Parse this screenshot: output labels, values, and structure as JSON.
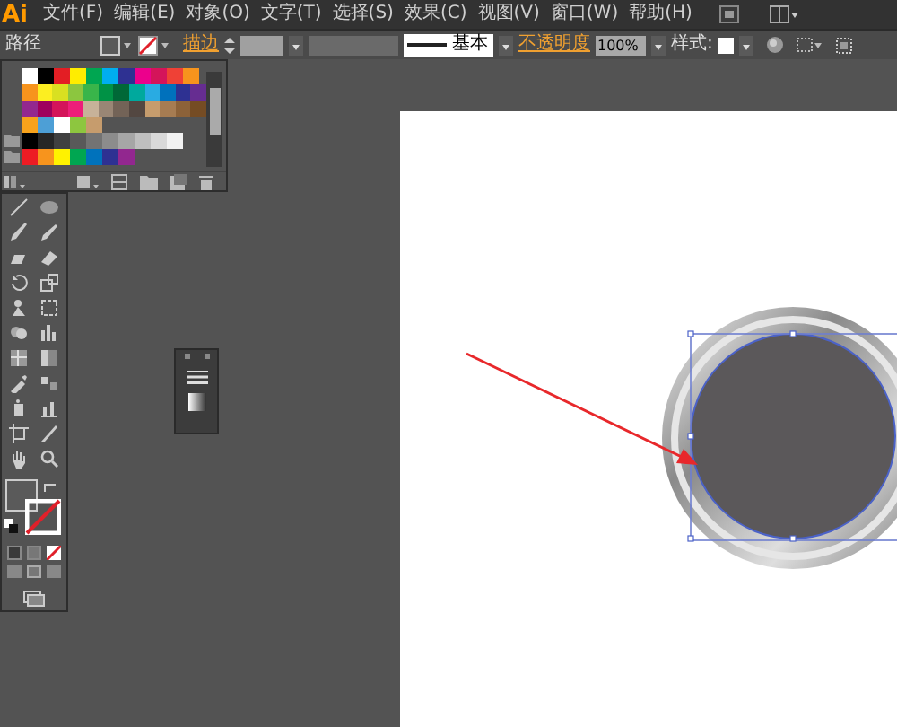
{
  "app": {
    "logo": "Ai"
  },
  "menu": [
    {
      "label": "文件(F)"
    },
    {
      "label": "编辑(E)"
    },
    {
      "label": "对象(O)"
    },
    {
      "label": "文字(T)"
    },
    {
      "label": "选择(S)"
    },
    {
      "label": "效果(C)"
    },
    {
      "label": "视图(V)"
    },
    {
      "label": "窗口(W)"
    },
    {
      "label": "帮助(H)"
    }
  ],
  "control_bar": {
    "object_type": "路径",
    "stroke_label": "描边",
    "stroke_profile": "基本",
    "opacity_label": "不透明度",
    "opacity": "100%",
    "style_label": "样式:"
  },
  "swatches": [
    {
      "rows": [
        {
          "color": "#ffffff"
        },
        {
          "color": "#000000"
        },
        {
          "color": "#e31e24"
        },
        {
          "color": "#ffed00"
        },
        {
          "color": "#00a651"
        },
        {
          "color": "#00aeef"
        },
        {
          "color": "#2e3192"
        },
        {
          "color": "#ec008c"
        },
        {
          "color": "#d4145a"
        },
        {
          "color": "#ef4136"
        },
        {
          "color": "#f7941d"
        }
      ]
    },
    {
      "rows": [
        {
          "color": "#f7941d"
        },
        {
          "color": "#fcee21"
        },
        {
          "color": "#d9e021"
        },
        {
          "color": "#8cc63f"
        },
        {
          "color": "#39b54a"
        },
        {
          "color": "#009245"
        },
        {
          "color": "#006837"
        },
        {
          "color": "#00a99d"
        },
        {
          "color": "#29abe2"
        },
        {
          "color": "#0071bc"
        },
        {
          "color": "#2e3192"
        },
        {
          "color": "#662d91"
        }
      ]
    },
    {
      "rows": [
        {
          "color": "#93278f"
        },
        {
          "color": "#9e005d"
        },
        {
          "color": "#d4145a"
        },
        {
          "color": "#ed1e79"
        },
        {
          "color": "#c7b299"
        },
        {
          "color": "#998675"
        },
        {
          "color": "#736357"
        },
        {
          "color": "#534741"
        },
        {
          "color": "#c69c6d"
        },
        {
          "color": "#a67c52"
        },
        {
          "color": "#8c6239"
        },
        {
          "color": "#754c24"
        }
      ]
    },
    {
      "rows": [
        {
          "color": "#f7a21b"
        },
        {
          "color": "#4d9fd6"
        },
        {
          "color": "#ffffff"
        },
        {
          "color": "#8dc63f"
        },
        {
          "color": "#c69c6d"
        }
      ]
    },
    {
      "rows": [
        {
          "color": "#000000"
        },
        {
          "color": "#262626"
        },
        {
          "color": "#404040"
        },
        {
          "color": "#595959"
        },
        {
          "color": "#737373"
        },
        {
          "color": "#8c8c8c"
        },
        {
          "color": "#a6a6a6"
        },
        {
          "color": "#bfbfbf"
        },
        {
          "color": "#d9d9d9"
        },
        {
          "color": "#f2f2f2"
        }
      ]
    },
    {
      "rows": [
        {
          "color": "#ed1c24"
        },
        {
          "color": "#f7941d"
        },
        {
          "color": "#fff200"
        },
        {
          "color": "#00a651"
        },
        {
          "color": "#0072bc"
        },
        {
          "color": "#2e3192"
        },
        {
          "color": "#92278f"
        }
      ]
    }
  ]
}
